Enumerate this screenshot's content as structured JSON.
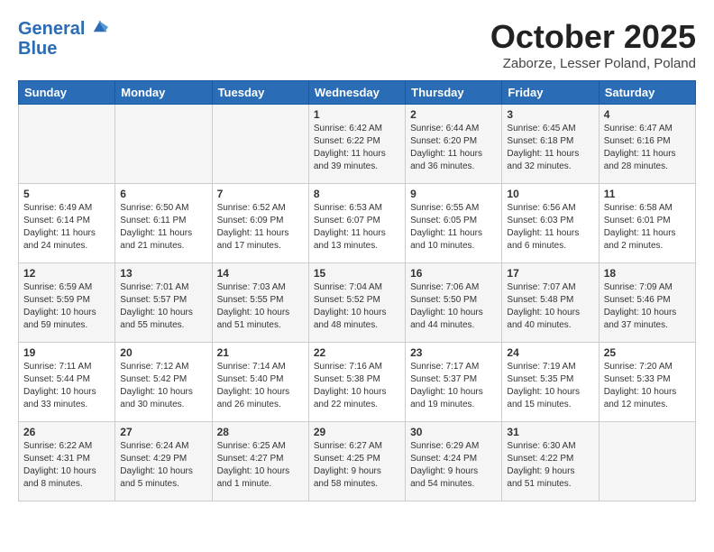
{
  "header": {
    "logo_line1": "General",
    "logo_line2": "Blue",
    "month": "October 2025",
    "location": "Zaborze, Lesser Poland, Poland"
  },
  "days_of_week": [
    "Sunday",
    "Monday",
    "Tuesday",
    "Wednesday",
    "Thursday",
    "Friday",
    "Saturday"
  ],
  "weeks": [
    [
      {
        "num": "",
        "info": ""
      },
      {
        "num": "",
        "info": ""
      },
      {
        "num": "",
        "info": ""
      },
      {
        "num": "1",
        "info": "Sunrise: 6:42 AM\nSunset: 6:22 PM\nDaylight: 11 hours\nand 39 minutes."
      },
      {
        "num": "2",
        "info": "Sunrise: 6:44 AM\nSunset: 6:20 PM\nDaylight: 11 hours\nand 36 minutes."
      },
      {
        "num": "3",
        "info": "Sunrise: 6:45 AM\nSunset: 6:18 PM\nDaylight: 11 hours\nand 32 minutes."
      },
      {
        "num": "4",
        "info": "Sunrise: 6:47 AM\nSunset: 6:16 PM\nDaylight: 11 hours\nand 28 minutes."
      }
    ],
    [
      {
        "num": "5",
        "info": "Sunrise: 6:49 AM\nSunset: 6:14 PM\nDaylight: 11 hours\nand 24 minutes."
      },
      {
        "num": "6",
        "info": "Sunrise: 6:50 AM\nSunset: 6:11 PM\nDaylight: 11 hours\nand 21 minutes."
      },
      {
        "num": "7",
        "info": "Sunrise: 6:52 AM\nSunset: 6:09 PM\nDaylight: 11 hours\nand 17 minutes."
      },
      {
        "num": "8",
        "info": "Sunrise: 6:53 AM\nSunset: 6:07 PM\nDaylight: 11 hours\nand 13 minutes."
      },
      {
        "num": "9",
        "info": "Sunrise: 6:55 AM\nSunset: 6:05 PM\nDaylight: 11 hours\nand 10 minutes."
      },
      {
        "num": "10",
        "info": "Sunrise: 6:56 AM\nSunset: 6:03 PM\nDaylight: 11 hours\nand 6 minutes."
      },
      {
        "num": "11",
        "info": "Sunrise: 6:58 AM\nSunset: 6:01 PM\nDaylight: 11 hours\nand 2 minutes."
      }
    ],
    [
      {
        "num": "12",
        "info": "Sunrise: 6:59 AM\nSunset: 5:59 PM\nDaylight: 10 hours\nand 59 minutes."
      },
      {
        "num": "13",
        "info": "Sunrise: 7:01 AM\nSunset: 5:57 PM\nDaylight: 10 hours\nand 55 minutes."
      },
      {
        "num": "14",
        "info": "Sunrise: 7:03 AM\nSunset: 5:55 PM\nDaylight: 10 hours\nand 51 minutes."
      },
      {
        "num": "15",
        "info": "Sunrise: 7:04 AM\nSunset: 5:52 PM\nDaylight: 10 hours\nand 48 minutes."
      },
      {
        "num": "16",
        "info": "Sunrise: 7:06 AM\nSunset: 5:50 PM\nDaylight: 10 hours\nand 44 minutes."
      },
      {
        "num": "17",
        "info": "Sunrise: 7:07 AM\nSunset: 5:48 PM\nDaylight: 10 hours\nand 40 minutes."
      },
      {
        "num": "18",
        "info": "Sunrise: 7:09 AM\nSunset: 5:46 PM\nDaylight: 10 hours\nand 37 minutes."
      }
    ],
    [
      {
        "num": "19",
        "info": "Sunrise: 7:11 AM\nSunset: 5:44 PM\nDaylight: 10 hours\nand 33 minutes."
      },
      {
        "num": "20",
        "info": "Sunrise: 7:12 AM\nSunset: 5:42 PM\nDaylight: 10 hours\nand 30 minutes."
      },
      {
        "num": "21",
        "info": "Sunrise: 7:14 AM\nSunset: 5:40 PM\nDaylight: 10 hours\nand 26 minutes."
      },
      {
        "num": "22",
        "info": "Sunrise: 7:16 AM\nSunset: 5:38 PM\nDaylight: 10 hours\nand 22 minutes."
      },
      {
        "num": "23",
        "info": "Sunrise: 7:17 AM\nSunset: 5:37 PM\nDaylight: 10 hours\nand 19 minutes."
      },
      {
        "num": "24",
        "info": "Sunrise: 7:19 AM\nSunset: 5:35 PM\nDaylight: 10 hours\nand 15 minutes."
      },
      {
        "num": "25",
        "info": "Sunrise: 7:20 AM\nSunset: 5:33 PM\nDaylight: 10 hours\nand 12 minutes."
      }
    ],
    [
      {
        "num": "26",
        "info": "Sunrise: 6:22 AM\nSunset: 4:31 PM\nDaylight: 10 hours\nand 8 minutes."
      },
      {
        "num": "27",
        "info": "Sunrise: 6:24 AM\nSunset: 4:29 PM\nDaylight: 10 hours\nand 5 minutes."
      },
      {
        "num": "28",
        "info": "Sunrise: 6:25 AM\nSunset: 4:27 PM\nDaylight: 10 hours\nand 1 minute."
      },
      {
        "num": "29",
        "info": "Sunrise: 6:27 AM\nSunset: 4:25 PM\nDaylight: 9 hours\nand 58 minutes."
      },
      {
        "num": "30",
        "info": "Sunrise: 6:29 AM\nSunset: 4:24 PM\nDaylight: 9 hours\nand 54 minutes."
      },
      {
        "num": "31",
        "info": "Sunrise: 6:30 AM\nSunset: 4:22 PM\nDaylight: 9 hours\nand 51 minutes."
      },
      {
        "num": "",
        "info": ""
      }
    ]
  ]
}
